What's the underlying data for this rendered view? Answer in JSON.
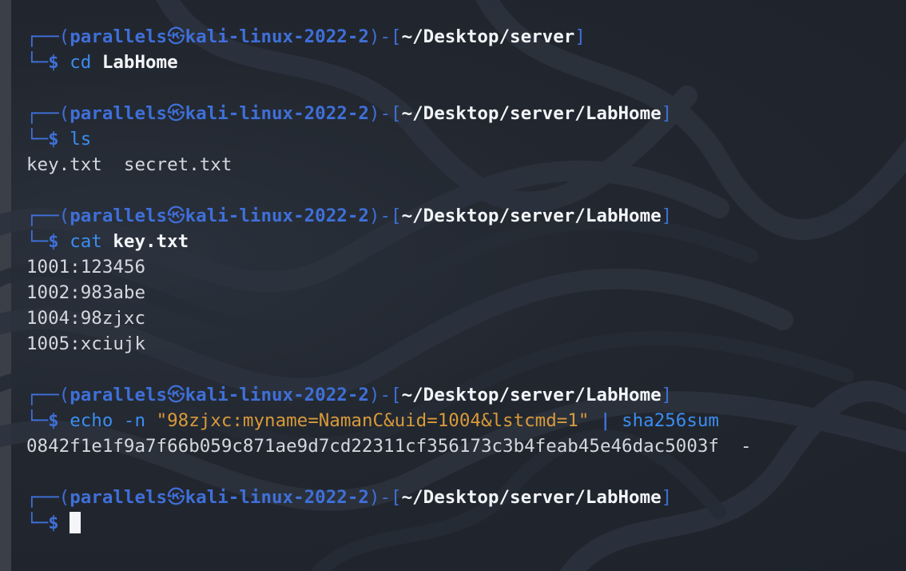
{
  "prompt": {
    "user": "parallels",
    "at_symbol": "㉿",
    "host": "kali-linux-2022-2",
    "dollar": "$"
  },
  "blocks": [
    {
      "path": "~/Desktop/server",
      "command": "cd",
      "args": "LabHome",
      "output": []
    },
    {
      "path": "~/Desktop/server/LabHome",
      "command": "ls",
      "args": "",
      "output": [
        "key.txt  secret.txt"
      ]
    },
    {
      "path": "~/Desktop/server/LabHome",
      "command": "cat",
      "args": "key.txt",
      "output": [
        "1001:123456",
        "1002:983abe",
        "1004:98zjxc",
        "1005:xciujk"
      ]
    },
    {
      "path": "~/Desktop/server/LabHome",
      "command": "echo",
      "flag": "-n",
      "string_arg": "\"98zjxc:myname=NamanC&uid=1004&lstcmd=1\"",
      "pipe": "|",
      "pipe_command": "sha256sum",
      "output": [
        "0842f1e1f9a7f66b059c871ae9d7cd22311cf356173c3b4feab45e46dac5003f  -"
      ]
    },
    {
      "path": "~/Desktop/server/LabHome",
      "command": "",
      "args": "",
      "output": []
    }
  ],
  "colors": {
    "background": "#22272f",
    "prompt_blue": "#3f6fd8",
    "command_blue": "#3b8df0",
    "string_orange": "#d99a3a",
    "text": "#d4d8de"
  }
}
